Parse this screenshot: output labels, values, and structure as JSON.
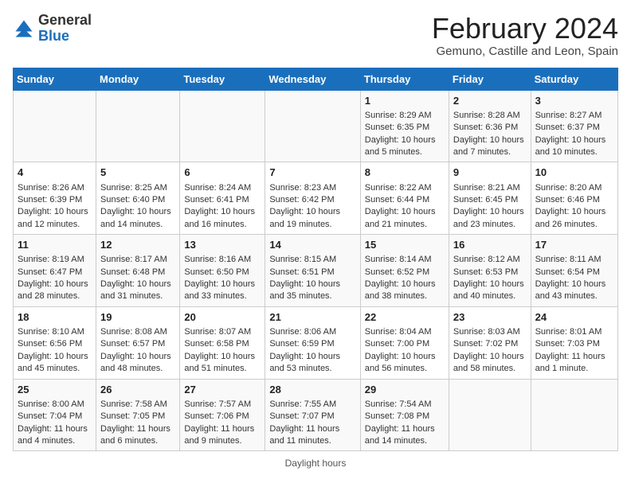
{
  "logo": {
    "general": "General",
    "blue": "Blue"
  },
  "header": {
    "title": "February 2024",
    "subtitle": "Gemuno, Castille and Leon, Spain"
  },
  "columns": [
    "Sunday",
    "Monday",
    "Tuesday",
    "Wednesday",
    "Thursday",
    "Friday",
    "Saturday"
  ],
  "weeks": [
    [
      {
        "day": "",
        "info": ""
      },
      {
        "day": "",
        "info": ""
      },
      {
        "day": "",
        "info": ""
      },
      {
        "day": "",
        "info": ""
      },
      {
        "day": "1",
        "info": "Sunrise: 8:29 AM\nSunset: 6:35 PM\nDaylight: 10 hours and 5 minutes."
      },
      {
        "day": "2",
        "info": "Sunrise: 8:28 AM\nSunset: 6:36 PM\nDaylight: 10 hours and 7 minutes."
      },
      {
        "day": "3",
        "info": "Sunrise: 8:27 AM\nSunset: 6:37 PM\nDaylight: 10 hours and 10 minutes."
      }
    ],
    [
      {
        "day": "4",
        "info": "Sunrise: 8:26 AM\nSunset: 6:39 PM\nDaylight: 10 hours and 12 minutes."
      },
      {
        "day": "5",
        "info": "Sunrise: 8:25 AM\nSunset: 6:40 PM\nDaylight: 10 hours and 14 minutes."
      },
      {
        "day": "6",
        "info": "Sunrise: 8:24 AM\nSunset: 6:41 PM\nDaylight: 10 hours and 16 minutes."
      },
      {
        "day": "7",
        "info": "Sunrise: 8:23 AM\nSunset: 6:42 PM\nDaylight: 10 hours and 19 minutes."
      },
      {
        "day": "8",
        "info": "Sunrise: 8:22 AM\nSunset: 6:44 PM\nDaylight: 10 hours and 21 minutes."
      },
      {
        "day": "9",
        "info": "Sunrise: 8:21 AM\nSunset: 6:45 PM\nDaylight: 10 hours and 23 minutes."
      },
      {
        "day": "10",
        "info": "Sunrise: 8:20 AM\nSunset: 6:46 PM\nDaylight: 10 hours and 26 minutes."
      }
    ],
    [
      {
        "day": "11",
        "info": "Sunrise: 8:19 AM\nSunset: 6:47 PM\nDaylight: 10 hours and 28 minutes."
      },
      {
        "day": "12",
        "info": "Sunrise: 8:17 AM\nSunset: 6:48 PM\nDaylight: 10 hours and 31 minutes."
      },
      {
        "day": "13",
        "info": "Sunrise: 8:16 AM\nSunset: 6:50 PM\nDaylight: 10 hours and 33 minutes."
      },
      {
        "day": "14",
        "info": "Sunrise: 8:15 AM\nSunset: 6:51 PM\nDaylight: 10 hours and 35 minutes."
      },
      {
        "day": "15",
        "info": "Sunrise: 8:14 AM\nSunset: 6:52 PM\nDaylight: 10 hours and 38 minutes."
      },
      {
        "day": "16",
        "info": "Sunrise: 8:12 AM\nSunset: 6:53 PM\nDaylight: 10 hours and 40 minutes."
      },
      {
        "day": "17",
        "info": "Sunrise: 8:11 AM\nSunset: 6:54 PM\nDaylight: 10 hours and 43 minutes."
      }
    ],
    [
      {
        "day": "18",
        "info": "Sunrise: 8:10 AM\nSunset: 6:56 PM\nDaylight: 10 hours and 45 minutes."
      },
      {
        "day": "19",
        "info": "Sunrise: 8:08 AM\nSunset: 6:57 PM\nDaylight: 10 hours and 48 minutes."
      },
      {
        "day": "20",
        "info": "Sunrise: 8:07 AM\nSunset: 6:58 PM\nDaylight: 10 hours and 51 minutes."
      },
      {
        "day": "21",
        "info": "Sunrise: 8:06 AM\nSunset: 6:59 PM\nDaylight: 10 hours and 53 minutes."
      },
      {
        "day": "22",
        "info": "Sunrise: 8:04 AM\nSunset: 7:00 PM\nDaylight: 10 hours and 56 minutes."
      },
      {
        "day": "23",
        "info": "Sunrise: 8:03 AM\nSunset: 7:02 PM\nDaylight: 10 hours and 58 minutes."
      },
      {
        "day": "24",
        "info": "Sunrise: 8:01 AM\nSunset: 7:03 PM\nDaylight: 11 hours and 1 minute."
      }
    ],
    [
      {
        "day": "25",
        "info": "Sunrise: 8:00 AM\nSunset: 7:04 PM\nDaylight: 11 hours and 4 minutes."
      },
      {
        "day": "26",
        "info": "Sunrise: 7:58 AM\nSunset: 7:05 PM\nDaylight: 11 hours and 6 minutes."
      },
      {
        "day": "27",
        "info": "Sunrise: 7:57 AM\nSunset: 7:06 PM\nDaylight: 11 hours and 9 minutes."
      },
      {
        "day": "28",
        "info": "Sunrise: 7:55 AM\nSunset: 7:07 PM\nDaylight: 11 hours and 11 minutes."
      },
      {
        "day": "29",
        "info": "Sunrise: 7:54 AM\nSunset: 7:08 PM\nDaylight: 11 hours and 14 minutes."
      },
      {
        "day": "",
        "info": ""
      },
      {
        "day": "",
        "info": ""
      }
    ]
  ],
  "footer": {
    "daylight_label": "Daylight hours"
  }
}
